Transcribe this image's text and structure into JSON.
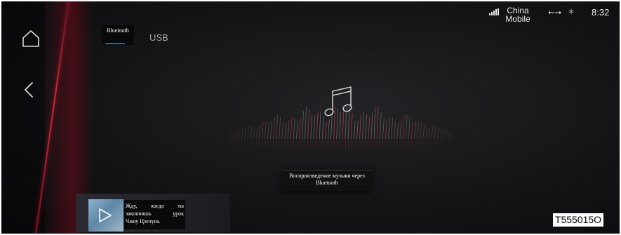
{
  "status_bar": {
    "carrier": "China Mobile",
    "usb_icon": "usb-icon",
    "bluetooth_icon": "bluetooth-icon",
    "time": "8:32"
  },
  "nav": {
    "home_icon": "home-icon",
    "back_icon": "back-icon"
  },
  "tabs": [
    {
      "label": "Bluetooth",
      "active": true
    },
    {
      "label": "USB",
      "active": false
    }
  ],
  "main": {
    "icon": "music-note-icon",
    "hint": "Воспроизведение музыки через Bluetooth"
  },
  "mini_player": {
    "title": "Жду, когда ты закончишь урок",
    "artist": "Чжоу Цзелунь"
  },
  "figure_code": "T555015O",
  "colors": {
    "accent": "#5dc8e0",
    "red_accent": "#e02840"
  }
}
